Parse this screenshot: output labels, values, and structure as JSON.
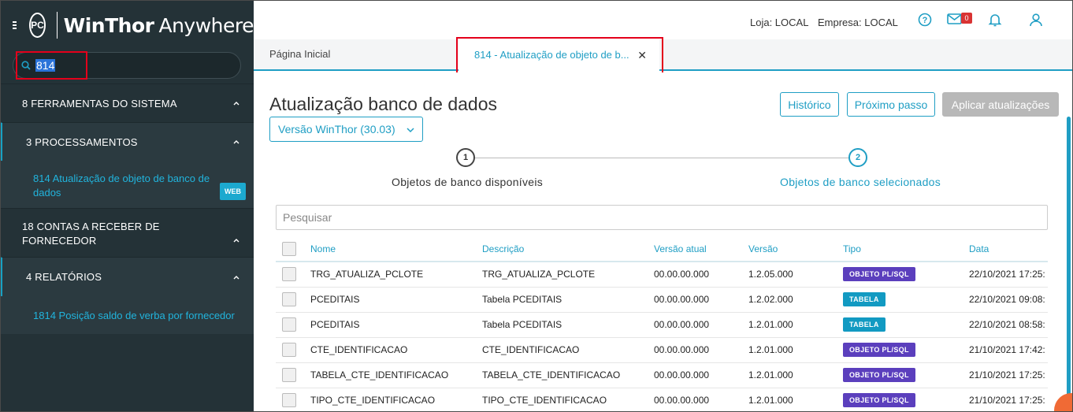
{
  "app": {
    "brand_bold": "WinThor",
    "brand_light": "Anywhere",
    "logo_text": "PC"
  },
  "search": {
    "value": "814"
  },
  "sidebar": {
    "groups": [
      {
        "label": "8   FERRAMENTAS DO SISTEMA"
      },
      {
        "label": "3   PROCESSAMENTOS"
      },
      {
        "label": "814   Atualização de objeto de banco de dados",
        "badge": "WEB"
      },
      {
        "label_line1": "18   CONTAS A RECEBER DE",
        "label_line2": "FORNECEDOR"
      },
      {
        "label": "4   RELATÓRIOS"
      },
      {
        "label": "1814   Posição saldo de verba por fornecedor"
      }
    ]
  },
  "header": {
    "loja": "Loja: LOCAL",
    "empresa": "Empresa: LOCAL",
    "mail_count": "0"
  },
  "tabs": {
    "home": "Página Inicial",
    "active": "814 - Atualização de objeto de b...",
    "close": "✕"
  },
  "main": {
    "title": "Atualização banco de dados",
    "version_select": "Versão WinThor (30.03)",
    "buttons": {
      "history": "Histórico",
      "next": "Próximo passo",
      "apply": "Aplicar atualizações"
    },
    "steps": [
      {
        "number": "1",
        "label": "Objetos de banco disponíveis"
      },
      {
        "number": "2",
        "label": "Objetos de banco selecionados"
      }
    ],
    "filter_placeholder": "Pesquisar"
  },
  "table": {
    "columns": [
      "Nome",
      "Descrição",
      "Versão atual",
      "Versão",
      "Tipo",
      "Data"
    ],
    "rows": [
      {
        "nome": "TRG_ATUALIZA_PCLOTE",
        "descricao": "TRG_ATUALIZA_PCLOTE",
        "versao_atual": "00.00.00.000",
        "versao": "1.2.05.000",
        "tipo": "OBJETO PL/SQL",
        "data": "22/10/2021 17:25:"
      },
      {
        "nome": "PCEDITAIS",
        "descricao": "Tabela PCEDITAIS",
        "versao_atual": "00.00.00.000",
        "versao": "1.2.02.000",
        "tipo": "TABELA",
        "data": "22/10/2021 09:08:"
      },
      {
        "nome": "PCEDITAIS",
        "descricao": "Tabela PCEDITAIS",
        "versao_atual": "00.00.00.000",
        "versao": "1.2.01.000",
        "tipo": "TABELA",
        "data": "22/10/2021 08:58:"
      },
      {
        "nome": "CTE_IDENTIFICACAO",
        "descricao": "CTE_IDENTIFICACAO",
        "versao_atual": "00.00.00.000",
        "versao": "1.2.01.000",
        "tipo": "OBJETO PL/SQL",
        "data": "21/10/2021 17:42:"
      },
      {
        "nome": "TABELA_CTE_IDENTIFICACAO",
        "descricao": "TABELA_CTE_IDENTIFICACAO",
        "versao_atual": "00.00.00.000",
        "versao": "1.2.01.000",
        "tipo": "OBJETO PL/SQL",
        "data": "21/10/2021 17:25:"
      },
      {
        "nome": "TIPO_CTE_IDENTIFICACAO",
        "descricao": "TIPO_CTE_IDENTIFICACAO",
        "versao_atual": "00.00.00.000",
        "versao": "1.2.01.000",
        "tipo": "OBJETO PL/SQL",
        "data": "21/10/2021 17:25:"
      }
    ]
  },
  "colors": {
    "accent": "#1f9ec4",
    "sidebar_bg": "#243237",
    "highlight": "#e4001b",
    "plsql": "#5b3fbd",
    "tabela": "#129ac2"
  },
  "icons": [
    "menu-icon",
    "search-icon",
    "chevron-up-icon",
    "help-icon",
    "mail-icon",
    "bell-icon",
    "user-icon",
    "close-icon",
    "chevron-down-icon"
  ]
}
